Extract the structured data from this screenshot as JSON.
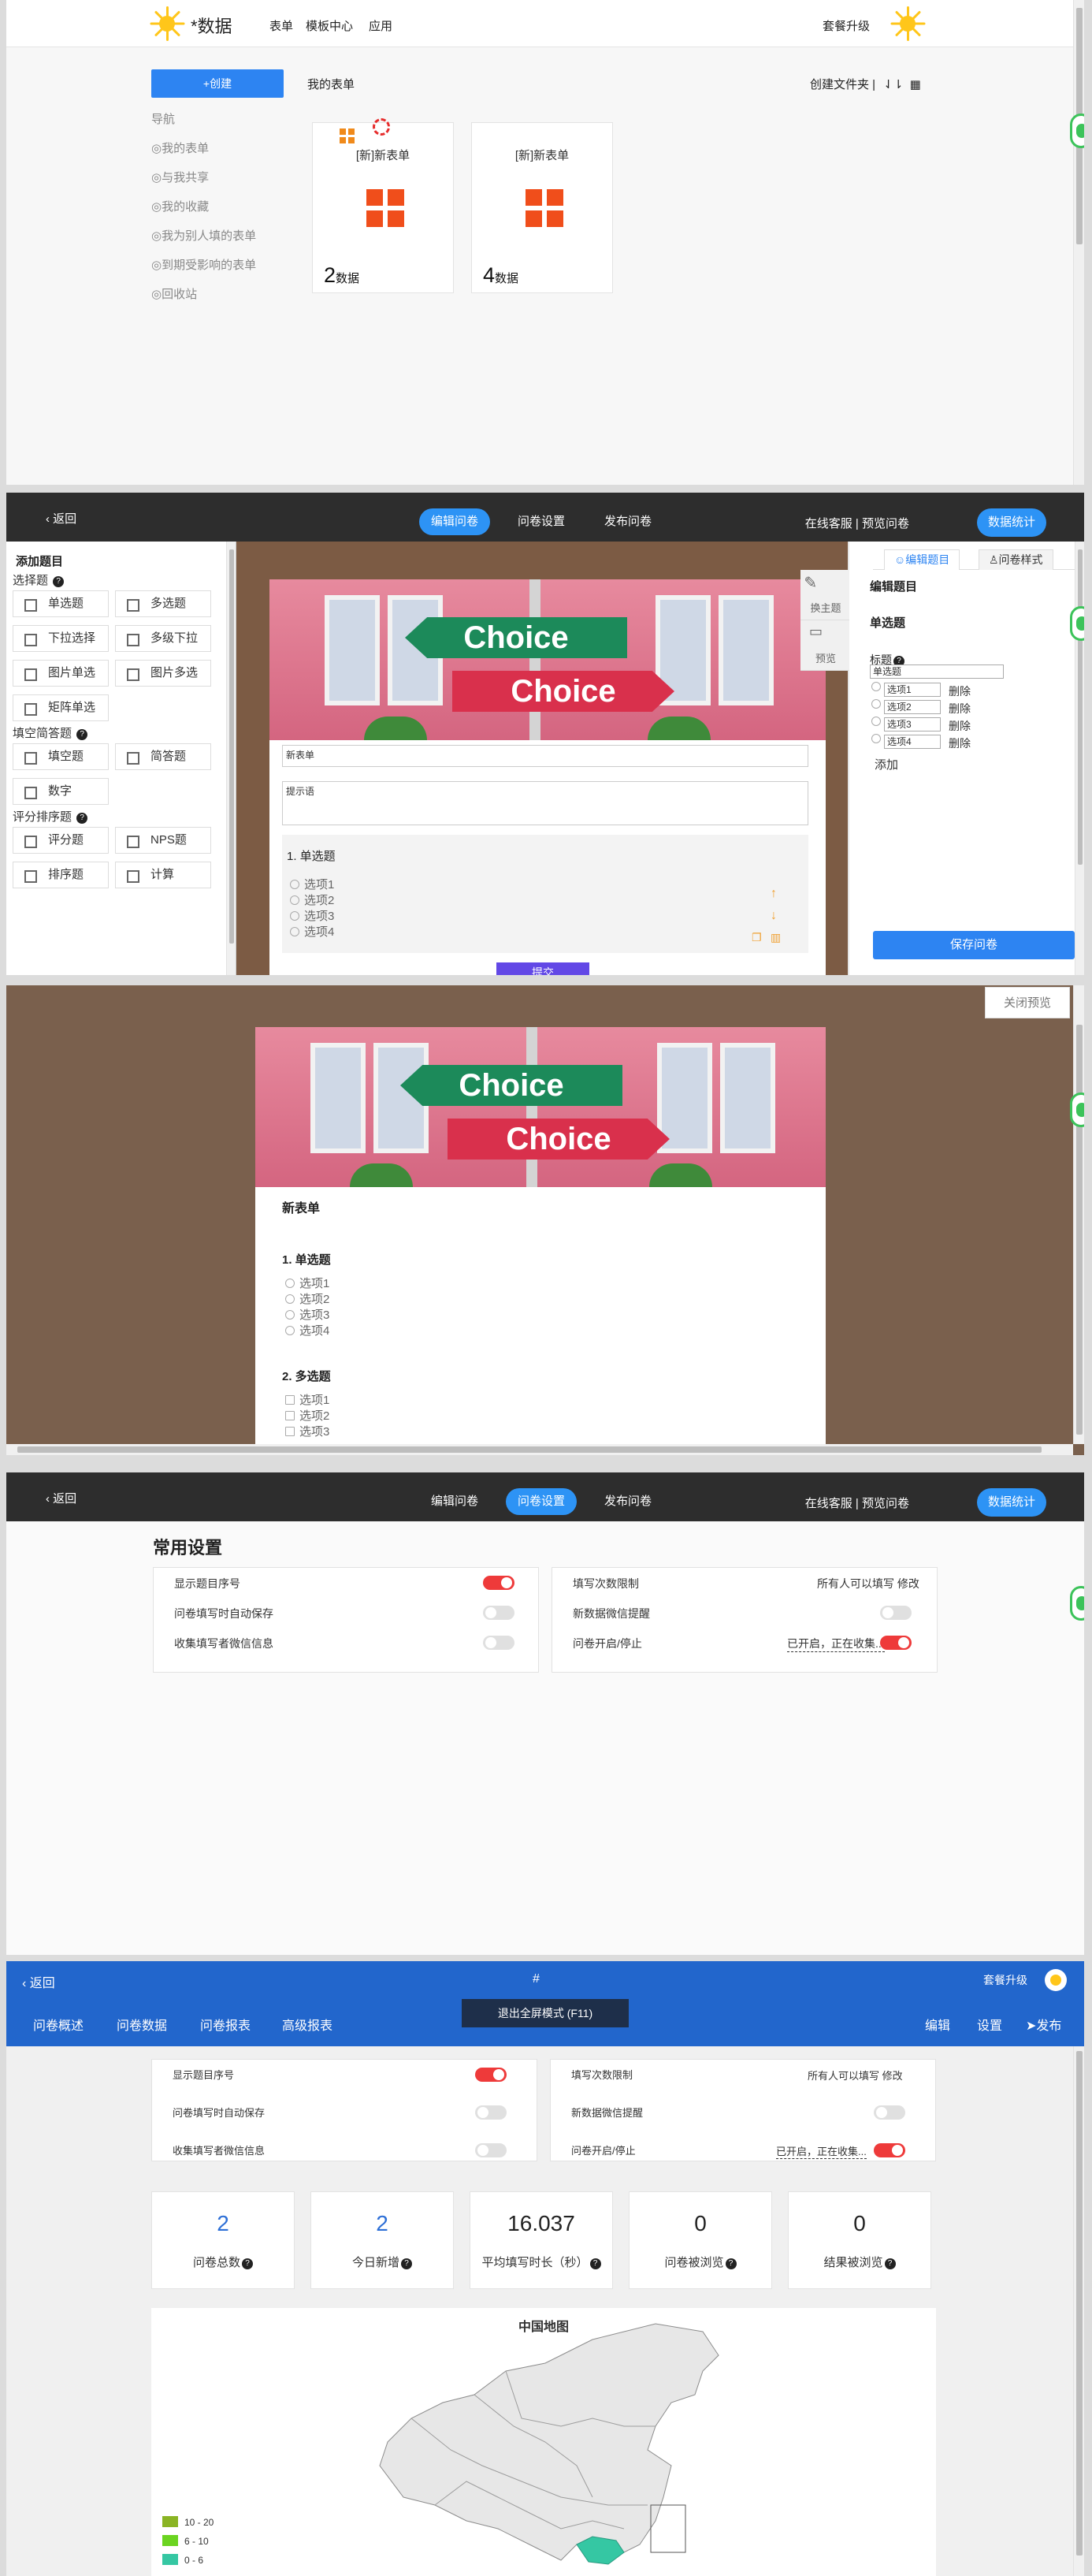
{
  "p1": {
    "brand": "*数据",
    "nav": [
      "表单",
      "模板中心",
      "应用"
    ],
    "upgrade": "套餐升级",
    "create": "+创建",
    "heading": "我的表单",
    "tools": "创建文件夹   |",
    "sidenav": [
      "导航",
      "◎我的表单",
      "◎与我共享",
      "◎我的收藏",
      "◎我为别人填的表单",
      "◎到期受影响的表单",
      "◎回收站"
    ],
    "cards": [
      {
        "title": "[新]新表单",
        "count": "2",
        "unit": "数据"
      },
      {
        "title": "[新]新表单",
        "count": "4",
        "unit": "数据"
      }
    ]
  },
  "p2": {
    "back": "返回",
    "tabs": [
      "编辑问卷",
      "问卷设置",
      "发布问卷"
    ],
    "links": "在线客服 |  预览问卷",
    "stats": "数据统计",
    "add_title": "添加题目",
    "sections": [
      "选择题",
      "填空简答题",
      "评分排序题"
    ],
    "choice": [
      "单选题",
      "多选题",
      "下拉选择",
      "多级下拉",
      "图片单选",
      "图片多选",
      "矩阵单选"
    ],
    "fill": [
      "填空题",
      "简答题",
      "数字"
    ],
    "score": [
      "评分题",
      "NPS题",
      "排序题",
      "计算"
    ],
    "sign_text": "Choice",
    "form_name": "新表单",
    "tip": "提示语",
    "q1": "1. 单选题",
    "options": [
      "选项1",
      "选项2",
      "选项3",
      "选项4"
    ],
    "submit": "提交",
    "tool_theme": "换主题",
    "tool_preview": "预览",
    "rp_tab1": "☺编辑题目",
    "rp_tab2": "♙问卷样式",
    "rp_title": "编辑题目",
    "rp_type": "单选题",
    "rp_label": "标题",
    "rp_value": "单选题",
    "rp_options": [
      "选项1",
      "选项2",
      "选项3",
      "选项4"
    ],
    "delete": "删除",
    "add": "添加",
    "save": "保存问卷"
  },
  "p3": {
    "close": "关闭预览",
    "sign_text": "Choice",
    "title": "新表单",
    "q1": "1. 单选题",
    "q1_options": [
      "选项1",
      "选项2",
      "选项3",
      "选项4"
    ],
    "q2": "2. 多选题",
    "q2_options": [
      "选项1",
      "选项2",
      "选项3"
    ]
  },
  "p4": {
    "back": "返回",
    "tabs": [
      "编辑问卷",
      "问卷设置",
      "发布问卷"
    ],
    "links": "在线客服 |  预览问卷",
    "stats": "数据统计",
    "title": "常用设置",
    "left": [
      "显示题目序号",
      "问卷填写时自动保存",
      "收集填写者微信信息"
    ],
    "right": [
      "填写次数限制",
      "新数据微信提醒",
      "问卷开启/停止"
    ],
    "limit_value": "所有人可以填写",
    "edit": "修改",
    "status_value": "已开启，正在收集..."
  },
  "p5": {
    "back": "返回",
    "hash": "#",
    "upgrade": "套餐升级",
    "tabs": [
      "问卷概述",
      "问卷数据",
      "问卷报表",
      "高级报表"
    ],
    "fullscreen": "退出全屏模式 (F11)",
    "actions": [
      "编辑",
      "设置",
      "发布"
    ],
    "left": [
      "显示题目序号",
      "问卷填写时自动保存",
      "收集填写者微信信息"
    ],
    "right": [
      "填写次数限制",
      "新数据微信提醒",
      "问卷开启/停止"
    ],
    "limit_value": "所有人可以填写",
    "edit": "修改",
    "status_value": "已开启，正在收集...",
    "stats": [
      {
        "value": "2",
        "label": "问卷总数"
      },
      {
        "value": "2",
        "label": "今日新增"
      },
      {
        "value": "16.037",
        "label": "平均填写时长（秒）"
      },
      {
        "value": "0",
        "label": "问卷被浏览"
      },
      {
        "value": "0",
        "label": "结果被浏览"
      }
    ],
    "map_title": "中国地图",
    "legend": [
      "10 - 20",
      "6 - 10",
      "0 - 6"
    ]
  },
  "colors": {
    "primary": "#2d84f2",
    "brand_blue": "#2266cc",
    "toggle_on": "#ee3a3a",
    "logo_sun": "#ffc61a",
    "icon_orange": "#f04e1b"
  }
}
